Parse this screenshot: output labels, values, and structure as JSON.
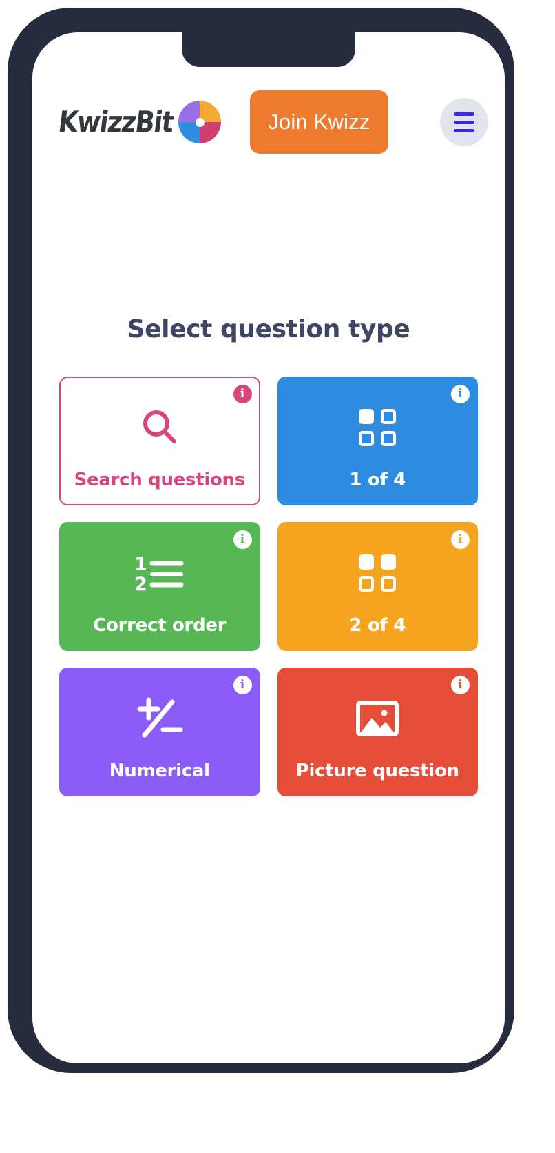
{
  "app": {
    "brand_name": "KwizzBit",
    "brand_icon": "pie-quadrant-logo",
    "join_button_label": "Join Kwizz",
    "menu_icon": "hamburger-icon"
  },
  "page": {
    "title": "Select question type"
  },
  "info_badge_label": "i",
  "colors": {
    "accent_orange": "#ee7a2e",
    "menu_purple": "#4226e0",
    "title_navy": "#3f4562",
    "pink": "#d6467d",
    "blue": "#2d8ce0",
    "green": "#57b754",
    "amber": "#f4a41f",
    "purple": "#8c5cf6",
    "red": "#e44d37"
  },
  "question_types": [
    {
      "label": "Search questions",
      "icon": "magnifier-icon",
      "style": "search",
      "color": "#d6467d"
    },
    {
      "label": "1 of 4",
      "icon": "grid-one-selected-icon",
      "style": "blue",
      "color": "#2d8ce0"
    },
    {
      "label": "Correct order",
      "icon": "numbered-list-icon",
      "style": "green",
      "color": "#57b754"
    },
    {
      "label": "2 of 4",
      "icon": "grid-two-selected-icon",
      "style": "orange",
      "color": "#f4a41f"
    },
    {
      "label": "Numerical",
      "icon": "plus-minus-icon",
      "style": "purple",
      "color": "#8c5cf6"
    },
    {
      "label": "Picture question",
      "icon": "image-icon",
      "style": "red",
      "color": "#e44d37"
    }
  ]
}
